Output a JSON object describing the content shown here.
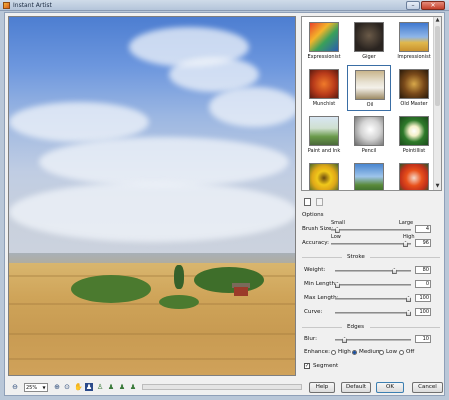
{
  "window": {
    "title": "Instant Artist",
    "min_glyph": "–",
    "close_glyph": "✕"
  },
  "styles": {
    "selected": "Oil",
    "items": [
      {
        "label": "Expressionist"
      },
      {
        "label": "Giger"
      },
      {
        "label": "Impressionist"
      },
      {
        "label": "Munchist"
      },
      {
        "label": "Oil"
      },
      {
        "label": "Old Master"
      },
      {
        "label": "Paint and Ink"
      },
      {
        "label": "Pencil"
      },
      {
        "label": "Pointillist"
      },
      {
        "label": ""
      },
      {
        "label": ""
      },
      {
        "label": ""
      }
    ]
  },
  "options": {
    "header": "Options",
    "brush_size": {
      "label": "Brush Size:",
      "min_label": "Small",
      "max_label": "Large",
      "value": "4",
      "level": 0.05
    },
    "accuracy": {
      "label": "Accuracy:",
      "min_label": "Low",
      "max_label": "High",
      "value": "96",
      "level": 0.96
    },
    "stroke_header": "Stroke",
    "weight": {
      "label": "Weight:",
      "value": "80",
      "level": 0.8
    },
    "min_length": {
      "label": "Min Length:",
      "value": "0",
      "level": 0.0
    },
    "max_length": {
      "label": "Max Length:",
      "value": "100",
      "level": 1.0
    },
    "curve": {
      "label": "Curve:",
      "value": "100",
      "level": 1.0
    },
    "edges_header": "Edges",
    "blur": {
      "label": "Blur:",
      "value": "10",
      "level": 0.1
    },
    "enhance": {
      "label": "Enhance:",
      "options": [
        "High",
        "Medium",
        "Low",
        "Off"
      ],
      "selected": "Medium"
    },
    "segment": {
      "label": "Segment",
      "checked": true
    }
  },
  "toolbar": {
    "zoom_value": "25%",
    "help_label": "Help",
    "default_label": "Default",
    "ok_label": "OK",
    "cancel_label": "Cancel"
  },
  "colors": {
    "accent": "#3a6ea5",
    "close_button": "#c4402b"
  }
}
